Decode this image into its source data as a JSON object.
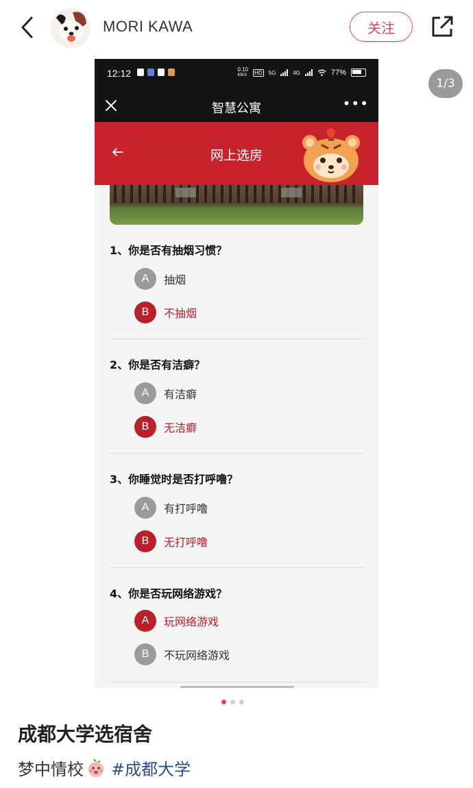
{
  "post": {
    "username": "MORI KAWA",
    "follow_label": "关注",
    "page_counter": "1/3",
    "title": "成都大学选宿舍",
    "body_text": "梦中情校",
    "hashtag": "#成都大学",
    "carousel": {
      "total": 3,
      "active": 1
    }
  },
  "phone": {
    "status": {
      "time": "12:12",
      "battery": "77%",
      "net_speed_top": "0.10",
      "net_speed_unit": "KB/S",
      "hd": "HD",
      "network_1": "5G",
      "network_2": "4G"
    },
    "mini_program_title": "智慧公寓",
    "more_label": "•••",
    "page_title": "网上选房",
    "questions": [
      {
        "title": "1、你是否有抽烟习惯？",
        "options": [
          {
            "key": "A",
            "label": "抽烟",
            "selected": false
          },
          {
            "key": "B",
            "label": "不抽烟",
            "selected": true
          }
        ]
      },
      {
        "title": "2、你是否有洁癖？",
        "options": [
          {
            "key": "A",
            "label": "有洁癖",
            "selected": false
          },
          {
            "key": "B",
            "label": "无洁癖",
            "selected": true
          }
        ]
      },
      {
        "title": "3、你睡觉时是否打呼噜？",
        "options": [
          {
            "key": "A",
            "label": "有打呼噜",
            "selected": false
          },
          {
            "key": "B",
            "label": "无打呼噜",
            "selected": true
          }
        ]
      },
      {
        "title": "4、你是否玩网络游戏？",
        "options": [
          {
            "key": "A",
            "label": "玩网络游戏",
            "selected": true
          },
          {
            "key": "B",
            "label": "不玩网络游戏",
            "selected": false
          }
        ]
      }
    ]
  },
  "colors": {
    "accent_red": "#c8232c",
    "selected_red": "#b8202a",
    "follow_pink": "#e2435a",
    "hashtag_blue": "#2d4e86",
    "unselected_gray": "#9b9b9b"
  },
  "icons": {
    "back": "chevron-left-icon",
    "share": "share-icon",
    "close": "close-icon",
    "tiger": "tiger-mascot-icon",
    "emoji": "peach-face-emoji-icon"
  }
}
